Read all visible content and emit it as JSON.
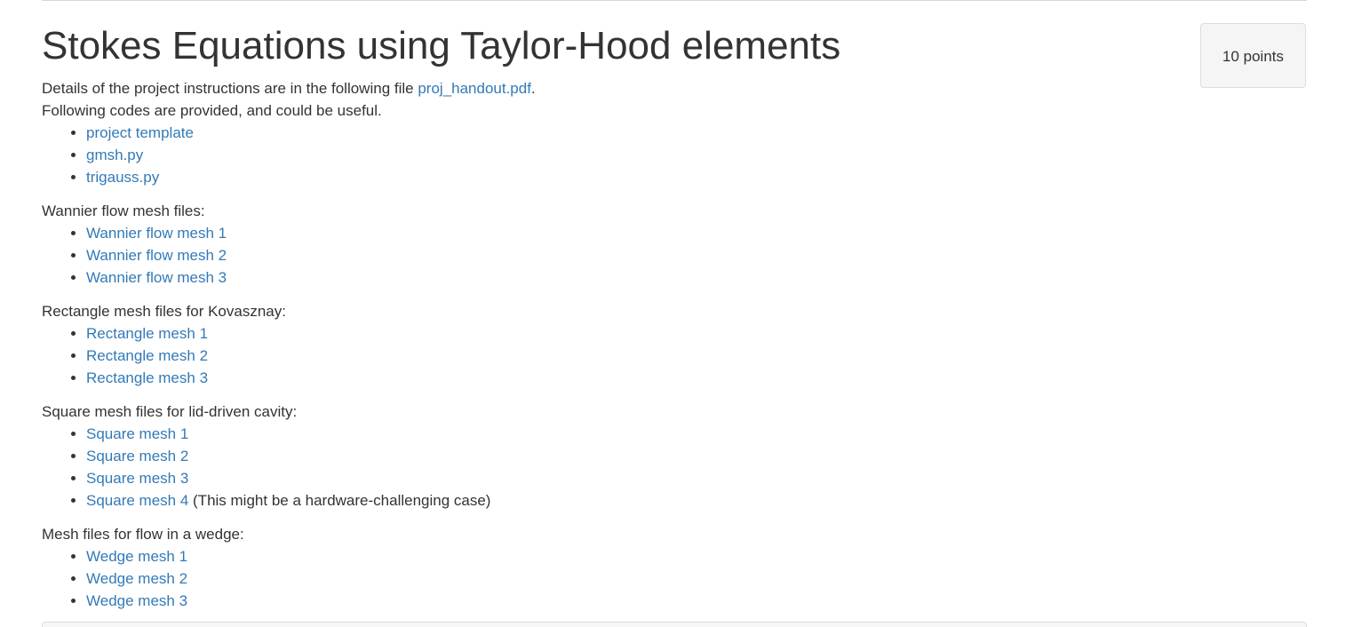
{
  "title": "Stokes Equations using Taylor-Hood elements",
  "points_badge": "10 points",
  "intro": {
    "details_prefix": "Details of the project instructions are in the following file ",
    "handout_link": "proj_handout.pdf",
    "details_suffix": ".",
    "codes_line": "Following codes are provided, and could be useful."
  },
  "code_links": [
    "project template",
    "gmsh.py",
    "trigauss.py"
  ],
  "sections": [
    {
      "heading": "Wannier flow mesh files:",
      "links": [
        "Wannier flow mesh 1",
        "Wannier flow mesh 2",
        "Wannier flow mesh 3"
      ]
    },
    {
      "heading": "Rectangle mesh files for Kovasznay:",
      "links": [
        "Rectangle mesh 1",
        "Rectangle mesh 2",
        "Rectangle mesh 3"
      ]
    },
    {
      "heading": "Square mesh files for lid-driven cavity:",
      "links": [
        "Square mesh 1",
        "Square mesh 2",
        "Square mesh 3",
        "Square mesh 4"
      ],
      "note_after_last": " (This might be a hardware-challenging case)"
    },
    {
      "heading": "Mesh files for flow in a wedge:",
      "links": [
        "Wedge mesh 1",
        "Wedge mesh 2",
        "Wedge mesh 3"
      ]
    }
  ],
  "colors": {
    "link": "#337ab7",
    "text": "#333333",
    "badge_bg": "#f5f5f5"
  }
}
